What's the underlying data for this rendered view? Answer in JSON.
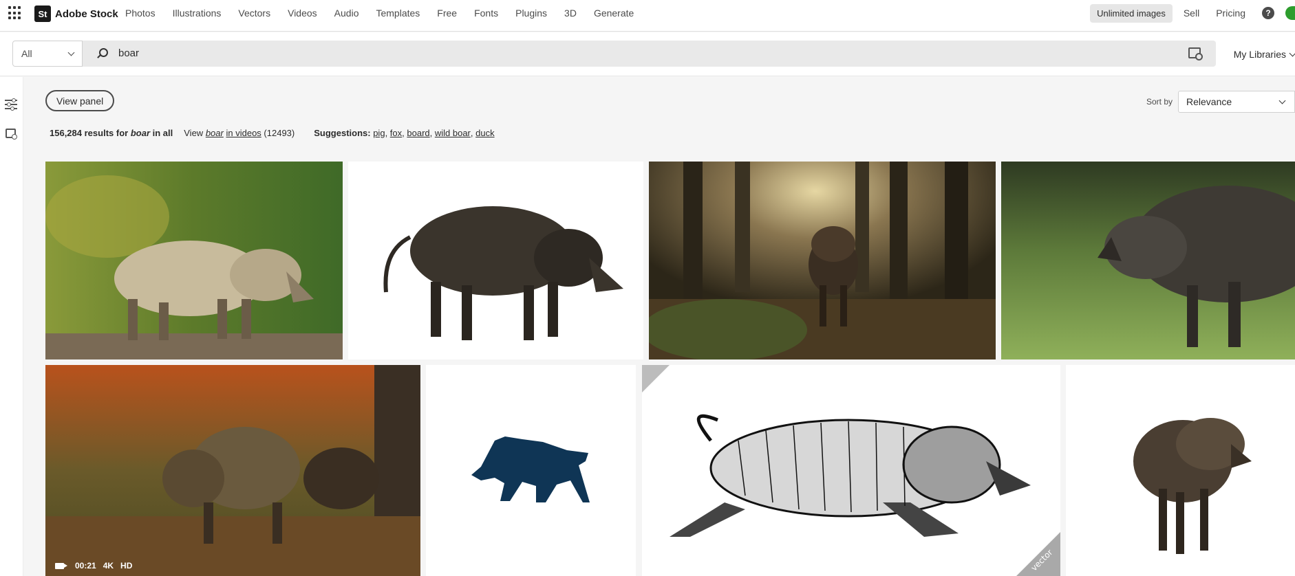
{
  "header": {
    "brand_badge": "St",
    "brand_name": "Adobe Stock",
    "nav": [
      "Photos",
      "Illustrations",
      "Vectors",
      "Videos",
      "Audio",
      "Templates",
      "Free",
      "Fonts",
      "Plugins",
      "3D",
      "Generate"
    ],
    "unlimited_label": "Unlimited images",
    "sell_label": "Sell",
    "pricing_label": "Pricing",
    "help_glyph": "?"
  },
  "search": {
    "scope_value": "All",
    "query": "boar",
    "libraries_label": "My Libraries"
  },
  "toolbar": {
    "view_panel_label": "View panel",
    "sort_label": "Sort by",
    "sort_value": "Relevance"
  },
  "summary": {
    "count": "156,284",
    "results_for": "results for",
    "term": "boar",
    "in_all": "in all",
    "view": "View",
    "view_term": "boar",
    "view_in_videos": "in videos",
    "video_count": "(12493)",
    "suggestions_label": "Suggestions:",
    "suggestions": [
      "pig",
      "fox",
      "board",
      "wild boar",
      "duck"
    ]
  },
  "results": {
    "video_badge": {
      "duration": "00:21",
      "res1": "4K",
      "res2": "HD"
    },
    "vector_flag": "vector"
  },
  "colors": {
    "accent_bg": "#f5f5f5",
    "logo_bg": "#1a1a1a",
    "silhouette": "#0f3555"
  }
}
